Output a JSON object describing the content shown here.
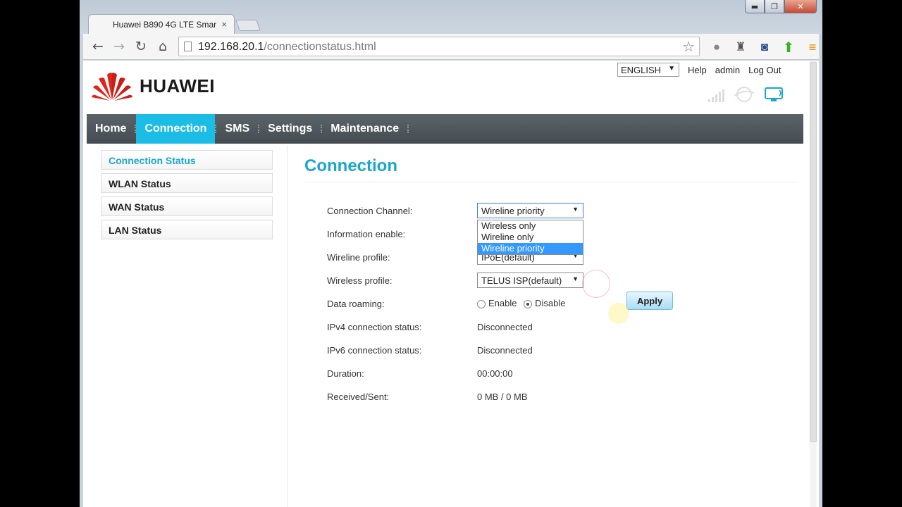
{
  "browser": {
    "tab_title": "Huawei B890 4G LTE Smar",
    "tab_close": "×",
    "url_host": "192.168.20.1",
    "url_path": "/connectionstatus.html",
    "window_controls": {
      "minimize": "▬",
      "maximize": "❐",
      "close": "✕"
    }
  },
  "header": {
    "logo_text": "HUAWEI",
    "language": "ENGLISH",
    "help": "Help",
    "user": "admin",
    "logout": "Log Out"
  },
  "nav": {
    "items": [
      {
        "label": "Home"
      },
      {
        "label": "Connection"
      },
      {
        "label": "SMS"
      },
      {
        "label": "Settings"
      },
      {
        "label": "Maintenance"
      }
    ],
    "active": "Connection"
  },
  "sidebar": {
    "items": [
      {
        "label": "Connection Status"
      },
      {
        "label": "WLAN Status"
      },
      {
        "label": "WAN Status"
      },
      {
        "label": "LAN Status"
      }
    ]
  },
  "page": {
    "title": "Connection",
    "fields": {
      "connection_channel": {
        "label": "Connection Channel:",
        "value": "Wireline priority"
      },
      "information_enable": {
        "label": "Information enable:"
      },
      "wireline_profile": {
        "label": "Wireline profile:",
        "value": "IPoE(default)"
      },
      "wireless_profile": {
        "label": "Wireless profile:",
        "value": "TELUS ISP(default)"
      },
      "data_roaming": {
        "label": "Data roaming:",
        "enable": "Enable",
        "disable": "Disable",
        "selected": "Disable"
      },
      "ipv4_status": {
        "label": "IPv4 connection status:",
        "value": "Disconnected"
      },
      "ipv6_status": {
        "label": "IPv6 connection status:",
        "value": "Disconnected"
      },
      "duration": {
        "label": "Duration:",
        "value": "00:00:00"
      },
      "received_sent": {
        "label": "Received/Sent:",
        "value": "0 MB / 0 MB"
      }
    },
    "channel_options": [
      "Wireless only",
      "Wireline only",
      "Wireline priority"
    ],
    "channel_highlighted": "Wireline priority",
    "apply": "Apply"
  },
  "colors": {
    "accent": "#1bbde6",
    "title": "#1aa7cf",
    "nav_bg": "#4b5358",
    "selection": "#3399ff"
  }
}
